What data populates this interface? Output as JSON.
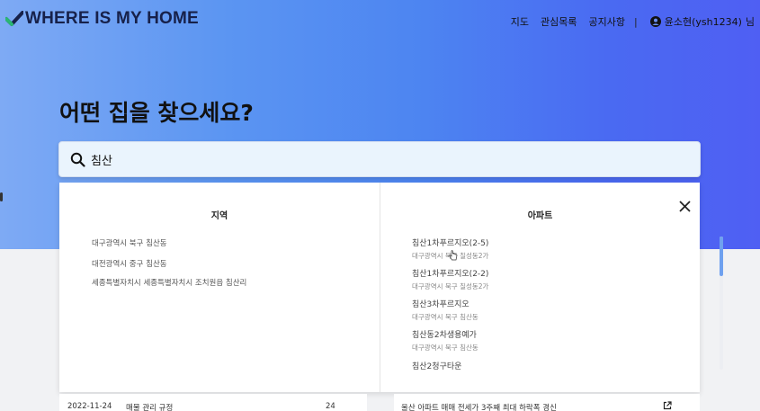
{
  "header": {
    "logo_text": "WHERE IS MY HOME",
    "logo_icon": "check-icon",
    "corner_text": "...",
    "nav": {
      "map": "지도",
      "favorites": "관심목록",
      "notice": "공지사항",
      "separator": "|",
      "user_name": "윤소현(ysh1234)",
      "user_suffix": "님",
      "user_icon": "user-circle-icon"
    }
  },
  "hero": {
    "headline": "어떤 집을 찾으세요?"
  },
  "search": {
    "value": "침산",
    "icon": "search-icon"
  },
  "dropdown": {
    "region_title": "지역",
    "apartment_title": "아파트",
    "regions": [
      "대구광역시 북구 침산동",
      "대전광역시 중구 침산동",
      "세종특별자치시 세종특별자치시 조치원읍 침산리"
    ],
    "apartments": [
      {
        "name": "침산1차푸르지오(2-5)",
        "address": "대구광역시 북구 칠성동2가"
      },
      {
        "name": "침산1차푸르지오(2-2)",
        "address": "대구광역시 북구 칠성동2가"
      },
      {
        "name": "침산3차푸르지오",
        "address": "대구광역시 북구 침산동"
      },
      {
        "name": "침산동2차생용예가",
        "address": "대구광역시 북구 침산동"
      },
      {
        "name": "침산2청구타운",
        "address": ""
      }
    ],
    "close_icon": "close-icon",
    "scroll_position": 0
  },
  "notice_row": {
    "date": "2022-11-24",
    "title": "매물 관리 규정",
    "count": "24"
  },
  "news_row": {
    "title": "울산 아파트 매매 전세가 3주째 최대 하락폭 경신",
    "icon": "external-link-icon"
  },
  "colors": {
    "hero_start": "#7eaaf4",
    "hero_end": "#4f5ff3",
    "logo": "#17214a",
    "search_bg": "#eaf4fd",
    "scroll_thumb": "#6fa1ef"
  }
}
